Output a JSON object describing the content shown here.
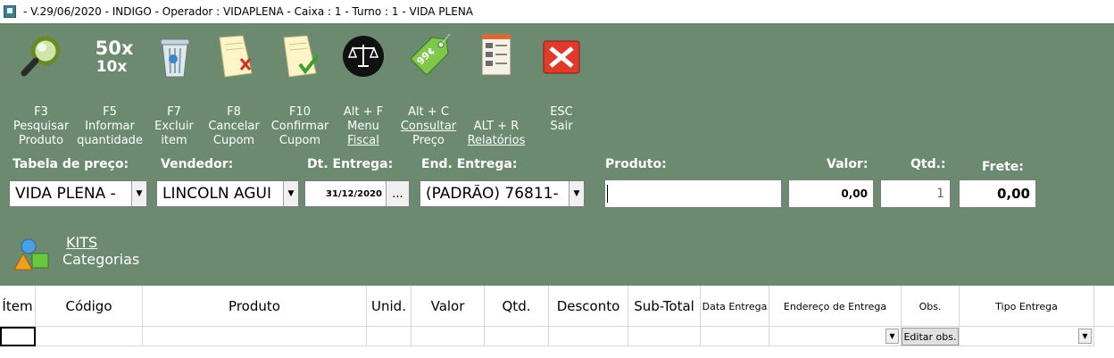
{
  "window": {
    "title": "- V.29/06/2020 - INDIGO - Operador : VIDAPLENA - Caixa : 1 - Turno : 1 - VIDA PLENA"
  },
  "colors": {
    "panel": "#6b8a70",
    "text_on_panel": "#ffffff"
  },
  "toolbar": [
    {
      "icon": "magnifier-icon",
      "key": "F3",
      "line1": "Pesquisar",
      "line2": "Produto"
    },
    {
      "icon": "quantity-icon",
      "key": "F5",
      "line1": "Informar",
      "line2": "quantidade",
      "icon_top": "50x",
      "icon_bottom": "10x"
    },
    {
      "icon": "trash-icon",
      "key": "F7",
      "line1": "Excluir",
      "line2": "item"
    },
    {
      "icon": "cancel-document-icon",
      "key": "F8",
      "line1": "Cancelar",
      "line2": "Cupom"
    },
    {
      "icon": "confirm-document-icon",
      "key": "F10",
      "line1": "Confirmar",
      "line2": "Cupom"
    },
    {
      "icon": "scales-icon",
      "key": "Alt + F",
      "line1": "Menu",
      "line2": "Fiscal"
    },
    {
      "icon": "price-tag-icon",
      "key": "Alt + C",
      "line1": "Consultar",
      "line2": "Preço",
      "icon_text": "99¢"
    },
    {
      "icon": "report-icon",
      "key": "ALT + R",
      "line1": "Relatórios",
      "line2": ""
    },
    {
      "icon": "exit-icon",
      "key": "ESC",
      "line1": "Sair",
      "line2": ""
    }
  ],
  "form": {
    "tabela_label": "Tabela de preço:",
    "tabela_value": "VIDA PLENA - ",
    "vendedor_label": "Vendedor:",
    "vendedor_value": "LINCOLN AGUI",
    "dt_entrega_label": "Dt. Entrega:",
    "dt_entrega_value": "31/12/2020",
    "dt_entrega_btn": "...",
    "end_entrega_label": "End. Entrega:",
    "end_entrega_value": "(PADRÃO) 76811-",
    "produto_label": "Produto:",
    "produto_value": "",
    "valor_label": "Valor:",
    "valor_value": "0,00",
    "qtd_label": "Qtd.:",
    "qtd_value": "1",
    "frete_label": "Frete:",
    "frete_value": "0,00"
  },
  "kits": {
    "line1": "KITS",
    "line2": "Categorias"
  },
  "grid": {
    "columns": [
      "Ítem",
      "Código",
      "Produto",
      "Unid.",
      "Valor",
      "Qtd.",
      "Desconto",
      "Sub-Total",
      "Data Entrega",
      "Endereço de Entrega",
      "Obs.",
      "Tipo Entrega"
    ],
    "edit_obs_label": "Editar obs."
  }
}
